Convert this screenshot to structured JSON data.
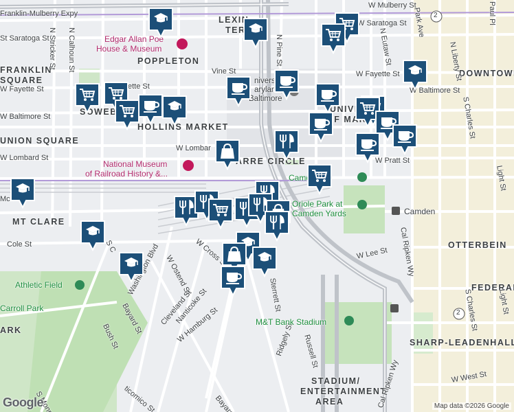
{
  "attribution": "Map data ©2026 Google",
  "logo": "Google",
  "districts": [
    {
      "id": "lexington-terrace-1",
      "text": "LEXIN"
    },
    {
      "id": "lexington-terrace-2",
      "text": "TERR"
    },
    {
      "id": "poppleton",
      "text": "POPPLETON"
    },
    {
      "id": "downtown",
      "text": "DOWNTOWN"
    },
    {
      "id": "franklin-square-1",
      "text": "FRANKLIN"
    },
    {
      "id": "franklin-square-2",
      "text": "SQUARE"
    },
    {
      "id": "sowebo",
      "text": "SOWEB"
    },
    {
      "id": "hollins-market",
      "text": "HOLLINS MARKET"
    },
    {
      "id": "university-1",
      "text": "UNIVERSIT"
    },
    {
      "id": "university-2",
      "text": "OF MARYLA"
    },
    {
      "id": "union-square",
      "text": "UNION SQUARE"
    },
    {
      "id": "barre-circle",
      "text": "ARRE CIRCLE"
    },
    {
      "id": "mt-clare",
      "text": "MT CLARE"
    },
    {
      "id": "otterbein",
      "text": "OTTERBEIN"
    },
    {
      "id": "federal-hill",
      "text": "FEDERAL"
    },
    {
      "id": "sharp-leadenhall",
      "text": "SHARP-LEADENHALL"
    },
    {
      "id": "stadium-1",
      "text": "STADIUM/"
    },
    {
      "id": "stadium-2",
      "text": "ENTERTAINMENT"
    },
    {
      "id": "stadium-3",
      "text": "AREA"
    },
    {
      "id": "park-left",
      "text": "ARK"
    }
  ],
  "streets": [
    {
      "id": "franklin-mulberry",
      "text": "Franklin-Mulberry Expy"
    },
    {
      "id": "w-mulberry",
      "text": "W Mulberry St"
    },
    {
      "id": "w-saratoga-left",
      "text": "St Saratoga St"
    },
    {
      "id": "w-saratoga-right",
      "text": "W Saratoga St"
    },
    {
      "id": "paul-pl",
      "text": "Paul Pl"
    },
    {
      "id": "park-ave",
      "text": "Park Ave"
    },
    {
      "id": "n-eutaw",
      "text": "N Eutaw St"
    },
    {
      "id": "n-liberty",
      "text": "N Liberty St"
    },
    {
      "id": "n-stricker",
      "text": "N Stricker St"
    },
    {
      "id": "n-calhoun",
      "text": "N Calhoun St"
    },
    {
      "id": "n-pine",
      "text": "N Pine St"
    },
    {
      "id": "vine-st",
      "text": "Vine St"
    },
    {
      "id": "w-fayette-left",
      "text": "W Fayette St"
    },
    {
      "id": "w-fayette-right",
      "text": "W Fayette St"
    },
    {
      "id": "w-baltimore-left",
      "text": "W Baltimore St"
    },
    {
      "id": "w-baltimore-mid",
      "text": "ette St"
    },
    {
      "id": "w-baltimore-right",
      "text": "W Baltimore St"
    },
    {
      "id": "w-lombard-left",
      "text": "W Lombard St"
    },
    {
      "id": "w-lombard-mid",
      "text": "W Lombar"
    },
    {
      "id": "w-pratt",
      "text": "W Pratt St"
    },
    {
      "id": "s-charles-top",
      "text": "S Charles St"
    },
    {
      "id": "light-st",
      "text": "Light St"
    },
    {
      "id": "camden",
      "text": "Camden"
    },
    {
      "id": "w-lee",
      "text": "W Lee St"
    },
    {
      "id": "cal-ripken",
      "text": "Cal Ripken Wy"
    },
    {
      "id": "cal-ripken-2",
      "text": "Cal Ripken Wy"
    },
    {
      "id": "washington-blvd",
      "text": "Washington Blvd"
    },
    {
      "id": "w-ostend",
      "text": "W Ostend St"
    },
    {
      "id": "w-cross",
      "text": "W Cross St"
    },
    {
      "id": "cleveland",
      "text": "Cleveland St"
    },
    {
      "id": "nanticoke",
      "text": "Nanticoke St"
    },
    {
      "id": "w-hamburg",
      "text": "W Hamburg St"
    },
    {
      "id": "bayard-1",
      "text": "Bayard St"
    },
    {
      "id": "bayard-2",
      "text": "Bayard"
    },
    {
      "id": "bush-st",
      "text": "Bush St"
    },
    {
      "id": "sterrett",
      "text": "Sterrett St"
    },
    {
      "id": "russell",
      "text": "Russell St"
    },
    {
      "id": "ridgely",
      "text": "Ridgely St"
    },
    {
      "id": "cole-st",
      "text": "Cole St"
    },
    {
      "id": "s-charles-bottom",
      "text": "S Charles St"
    },
    {
      "id": "w-west",
      "text": "W West St"
    },
    {
      "id": "light-st-2",
      "text": "Light St"
    },
    {
      "id": "s-monroe",
      "text": "S Monro"
    },
    {
      "id": "s-c",
      "text": "S C"
    },
    {
      "id": "ticomico",
      "text": "ticomico St"
    },
    {
      "id": "mcn",
      "text": "Mcn"
    }
  ],
  "pois": [
    {
      "id": "poe-house-1",
      "text": "Edgar Allan Poe"
    },
    {
      "id": "poe-house-2",
      "text": "House & Museum"
    },
    {
      "id": "railroad-1",
      "text": "National Museum"
    },
    {
      "id": "railroad-2",
      "text": "of Railroad History &..."
    },
    {
      "id": "university-md-1",
      "text": "niversity"
    },
    {
      "id": "university-md-2",
      "text": "aryland,"
    },
    {
      "id": "university-md-3",
      "text": "Baltimore"
    },
    {
      "id": "camden-yards",
      "text": "Camd    ards"
    },
    {
      "id": "oriole-park-1",
      "text": "Oriole Park at"
    },
    {
      "id": "oriole-park-2",
      "text": "Camden Yards"
    },
    {
      "id": "athletic-field",
      "text": "Athletic Field"
    },
    {
      "id": "carroll-park",
      "text": "Carroll Park"
    },
    {
      "id": "mt-bank-stadium",
      "text": "M&T Bank Stadium"
    }
  ],
  "routes": [
    {
      "id": "route-2-top",
      "text": "2"
    },
    {
      "id": "route-2-bottom",
      "text": "2"
    }
  ],
  "markers": [
    {
      "id": "m1",
      "type": "school"
    },
    {
      "id": "m2",
      "type": "school"
    },
    {
      "id": "m3",
      "type": "cart"
    },
    {
      "id": "m4",
      "type": "cart"
    },
    {
      "id": "m5",
      "type": "coffee"
    },
    {
      "id": "m6",
      "type": "school"
    },
    {
      "id": "m7",
      "type": "cart"
    },
    {
      "id": "m8",
      "type": "cart"
    },
    {
      "id": "m9",
      "type": "coffee"
    },
    {
      "id": "m10",
      "type": "coffee"
    },
    {
      "id": "m11",
      "type": "coffee"
    },
    {
      "id": "m12",
      "type": "school"
    },
    {
      "id": "m13",
      "type": "cart"
    },
    {
      "id": "m14",
      "type": "cart"
    },
    {
      "id": "m15",
      "type": "cart"
    },
    {
      "id": "m16",
      "type": "coffee"
    },
    {
      "id": "m17",
      "type": "coffee"
    },
    {
      "id": "m18",
      "type": "restaurant"
    },
    {
      "id": "m19",
      "type": "coffee"
    },
    {
      "id": "m20",
      "type": "coffee"
    },
    {
      "id": "m21",
      "type": "bag"
    },
    {
      "id": "m22",
      "type": "cart"
    },
    {
      "id": "m23",
      "type": "school"
    },
    {
      "id": "m24",
      "type": "restaurant"
    },
    {
      "id": "m25",
      "type": "restaurant"
    },
    {
      "id": "m26",
      "type": "restaurant"
    },
    {
      "id": "m27",
      "type": "cart"
    },
    {
      "id": "m28",
      "type": "restaurant"
    },
    {
      "id": "m29",
      "type": "restaurant"
    },
    {
      "id": "m30",
      "type": "bag"
    },
    {
      "id": "m31",
      "type": "restaurant"
    },
    {
      "id": "m32",
      "type": "school"
    },
    {
      "id": "m33",
      "type": "school"
    },
    {
      "id": "m34",
      "type": "school"
    },
    {
      "id": "m35",
      "type": "bag"
    },
    {
      "id": "m36",
      "type": "school"
    },
    {
      "id": "m37",
      "type": "coffee"
    }
  ]
}
